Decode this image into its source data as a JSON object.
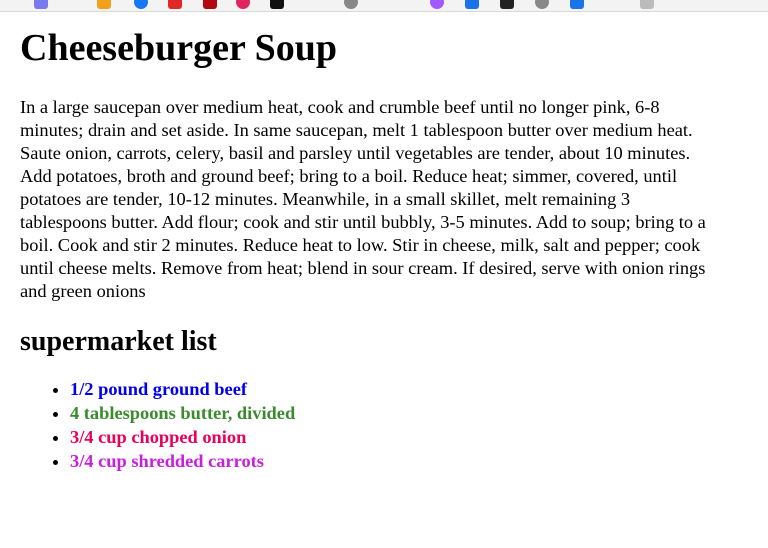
{
  "browser": {
    "toolbar_icons": [
      {
        "name": "extension-icon-1",
        "color": "#7a7af0"
      },
      {
        "name": "extension-icon-2",
        "color": "#f4a01c"
      },
      {
        "name": "extension-icon-3",
        "color": "#1877f2"
      },
      {
        "name": "extension-icon-4",
        "color": "#e02828"
      },
      {
        "name": "extension-icon-5",
        "color": "#b20710"
      },
      {
        "name": "extension-icon-6",
        "color": "#e0245e"
      },
      {
        "name": "extension-icon-7",
        "color": "#111111"
      },
      {
        "name": "globe-icon",
        "color": "#888888"
      },
      {
        "name": "extension-icon-9",
        "color": "#a259ff"
      },
      {
        "name": "extension-icon-10",
        "color": "#1a73e8"
      },
      {
        "name": "extension-icon-11",
        "color": "#222222"
      },
      {
        "name": "extension-icon-12",
        "color": "#888888"
      },
      {
        "name": "extension-icon-13",
        "color": "#1a73e8"
      },
      {
        "name": "extension-icon-14",
        "color": "#bbbbbb"
      }
    ]
  },
  "page": {
    "title": "Cheeseburger Soup",
    "instructions": "In a large saucepan over medium heat, cook and crumble beef until no longer pink, 6-8 minutes; drain and set aside. In same saucepan, melt 1 tablespoon butter over medium heat. Saute onion, carrots, celery, basil and parsley until vegetables are tender, about 10 minutes. Add potatoes, broth and ground beef; bring to a boil. Reduce heat; simmer, covered, until potatoes are tender, 10-12 minutes. Meanwhile, in a small skillet, melt remaining 3 tablespoons butter. Add flour; cook and stir until bubbly, 3-5 minutes. Add to soup; bring to a boil. Cook and stir 2 minutes. Reduce heat to low. Stir in cheese, milk, salt and pepper; cook until cheese melts. Remove from heat; blend in sour cream. If desired, serve with onion rings and green onions",
    "list_heading": "supermarket list",
    "list_items": [
      {
        "text": "1/2 pound ground beef",
        "color": "#0000ee"
      },
      {
        "text": "4 tablespoons butter, divided",
        "color": "#3a8a2e"
      },
      {
        "text": "3/4 cup chopped onion",
        "color": "#e8005a"
      },
      {
        "text": "3/4 cup shredded carrots",
        "color": "#c81ee0"
      }
    ]
  }
}
